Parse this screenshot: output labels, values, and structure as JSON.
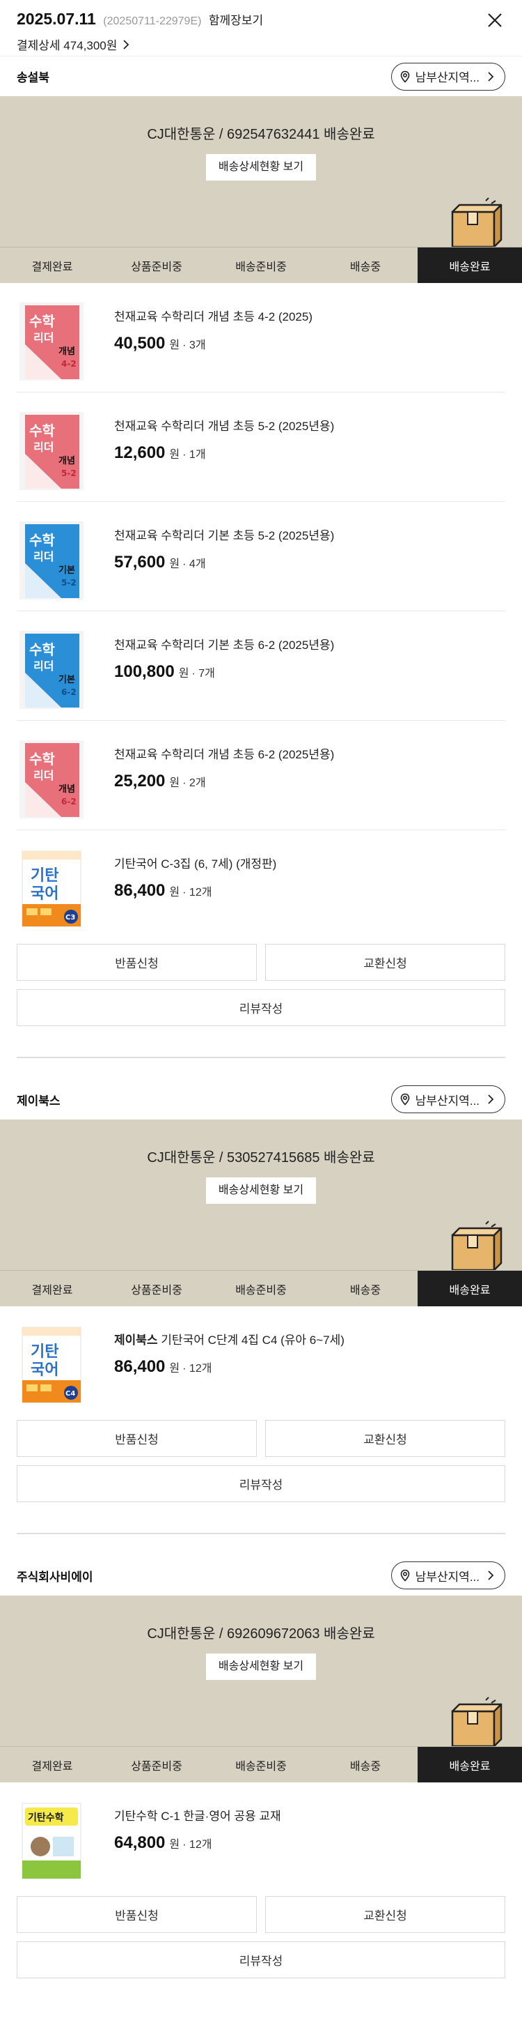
{
  "header": {
    "date": "2025.07.11",
    "order_no": "(20250711-22979E)",
    "together_label": "함께장보기",
    "payment_label": "결제상세 474,300원"
  },
  "sections": [
    {
      "seller": "송설북",
      "region_label": "남부산지역...",
      "courier": "CJ대한통운 / 692547632441 배송완료",
      "track_label": "배송상세현황 보기",
      "steps": [
        "결제완료",
        "상품준비중",
        "배송준비중",
        "배송중",
        "배송완료"
      ],
      "active_step": 4,
      "products": [
        {
          "name": "천재교육 수학리더 개념 초등 4-2 (2025)",
          "price": "40,500",
          "unit": "원",
          "qty": "· 3개",
          "cover": "pink",
          "cover_text": "개념",
          "cover_grade": "4-2"
        },
        {
          "name": "천재교육 수학리더 개념 초등 5-2 (2025년용)",
          "price": "12,600",
          "unit": "원",
          "qty": "· 1개",
          "cover": "pink",
          "cover_text": "개념",
          "cover_grade": "5-2"
        },
        {
          "name": "천재교육 수학리더 기본 초등 5-2 (2025년용)",
          "price": "57,600",
          "unit": "원",
          "qty": "· 4개",
          "cover": "blue",
          "cover_text": "기본",
          "cover_grade": "5-2"
        },
        {
          "name": "천재교육 수학리더 기본 초등 6-2 (2025년용)",
          "price": "100,800",
          "unit": "원",
          "qty": "· 7개",
          "cover": "blue",
          "cover_text": "기본",
          "cover_grade": "6-2"
        },
        {
          "name": "천재교육 수학리더 개념 초등 6-2 (2025년용)",
          "price": "25,200",
          "unit": "원",
          "qty": "· 2개",
          "cover": "pink",
          "cover_text": "개념",
          "cover_grade": "6-2"
        },
        {
          "name": "기탄국어 C-3집 (6, 7세) (개정판)",
          "price": "86,400",
          "unit": "원",
          "qty": "· 12개",
          "cover": "gitan",
          "cover_text": "기탄 국어",
          "cover_grade": "C3"
        }
      ],
      "buttons": {
        "return": "반품신청",
        "exchange": "교환신청",
        "review": "리뷰작성"
      }
    },
    {
      "seller": "제이북스",
      "region_label": "남부산지역...",
      "courier": "CJ대한통운 / 530527415685 배송완료",
      "track_label": "배송상세현황 보기",
      "steps": [
        "결제완료",
        "상품준비중",
        "배송준비중",
        "배송중",
        "배송완료"
      ],
      "active_step": 4,
      "products": [
        {
          "brand": "제이북스",
          "name": " 기탄국어 C단계 4집 C4 (유아 6~7세)",
          "price": "86,400",
          "unit": "원",
          "qty": "· 12개",
          "cover": "gitan",
          "cover_text": "기탄 국어",
          "cover_grade": "C4"
        }
      ],
      "buttons": {
        "return": "반품신청",
        "exchange": "교환신청",
        "review": "리뷰작성"
      }
    },
    {
      "seller": "주식회사비에이",
      "region_label": "남부산지역...",
      "courier": "CJ대한통운 / 692609672063 배송완료",
      "track_label": "배송상세현황 보기",
      "steps": [
        "결제완료",
        "상품준비중",
        "배송준비중",
        "배송중",
        "배송완료"
      ],
      "active_step": 4,
      "products": [
        {
          "name": "기탄수학 C-1 한글·영어 공용 교재",
          "price": "64,800",
          "unit": "원",
          "qty": "· 12개",
          "cover": "gitanmath",
          "cover_text": "기탄수학",
          "cover_grade": ""
        }
      ],
      "buttons": {
        "return": "반품신청",
        "exchange": "교환신청",
        "review": "리뷰작성"
      }
    }
  ],
  "colors": {
    "delivery_bg": "#d7d1c2",
    "active_step": "#1f1f1f",
    "pink_cover": "#e8707a",
    "blue_cover": "#2a8fd6",
    "gitan_orange": "#f08a1c"
  },
  "icons": [
    "close-icon",
    "chevron-right-icon",
    "location-pin-icon",
    "delivery-box-icon"
  ]
}
